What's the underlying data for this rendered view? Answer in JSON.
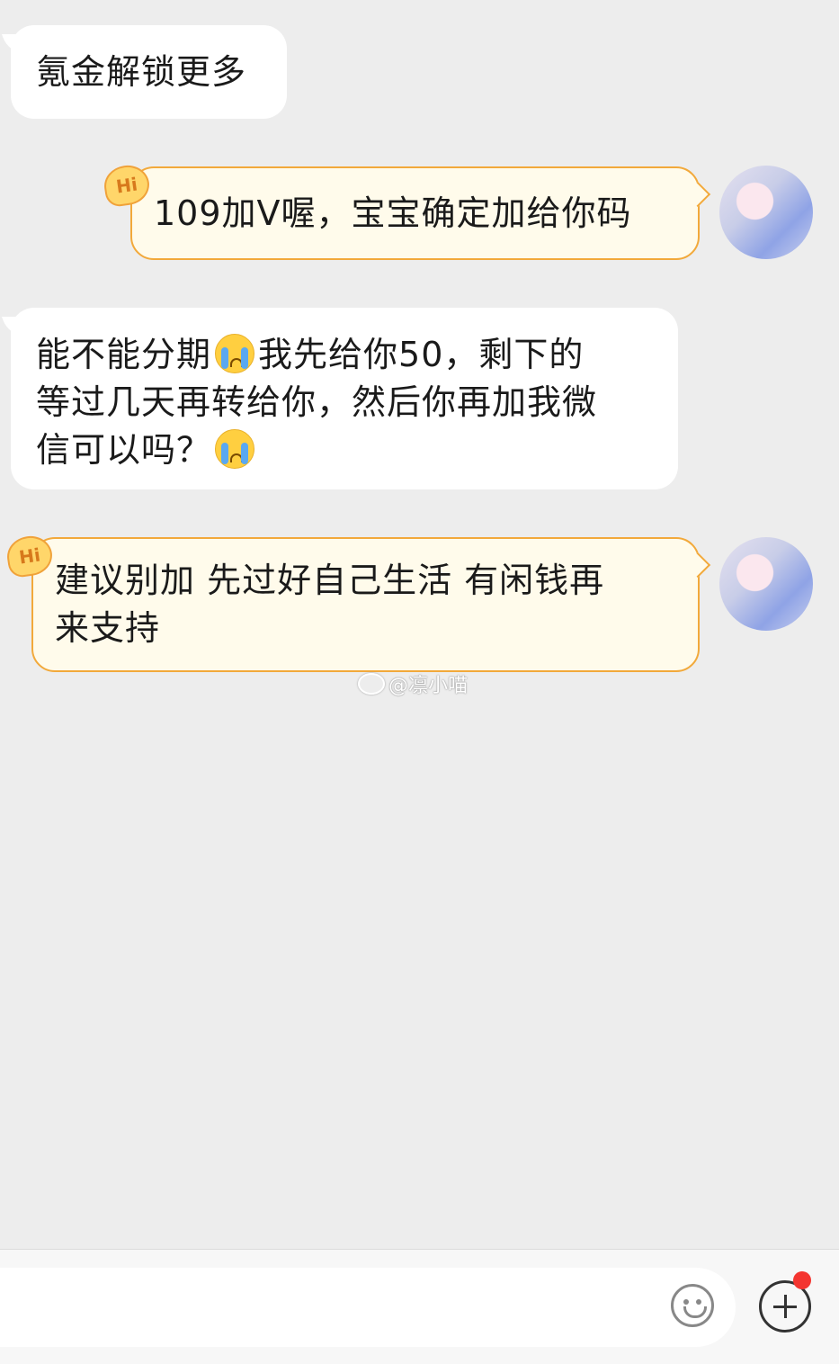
{
  "messages": [
    {
      "side": "in",
      "text": "氪金解锁更多"
    },
    {
      "side": "out",
      "badge": "Hi",
      "text": "109加V喔，宝宝确定加给你码"
    },
    {
      "side": "in",
      "lines": [
        "能不能分期",
        "我先给你50，剩下的",
        "等过几天再转给你，然后你再加我微",
        "信可以吗？"
      ],
      "emoji": "loudly-crying-face"
    },
    {
      "side": "out",
      "badge": "Hi",
      "lines": [
        "建议别加 先过好自己生活 有闲钱再",
        "来支持"
      ]
    }
  ],
  "watermark": {
    "text": "@凛小喵",
    "icon": "weibo-icon"
  },
  "input_bar": {
    "placeholder": "",
    "emoji_icon": "smiley-icon",
    "plus_icon": "plus-circle-icon",
    "notification_dot_color": "#f43530"
  },
  "colors": {
    "background": "#ededed",
    "incoming_bubble": "#ffffff",
    "outgoing_bubble": "#fffbeb",
    "outgoing_border": "#f2a93b"
  }
}
